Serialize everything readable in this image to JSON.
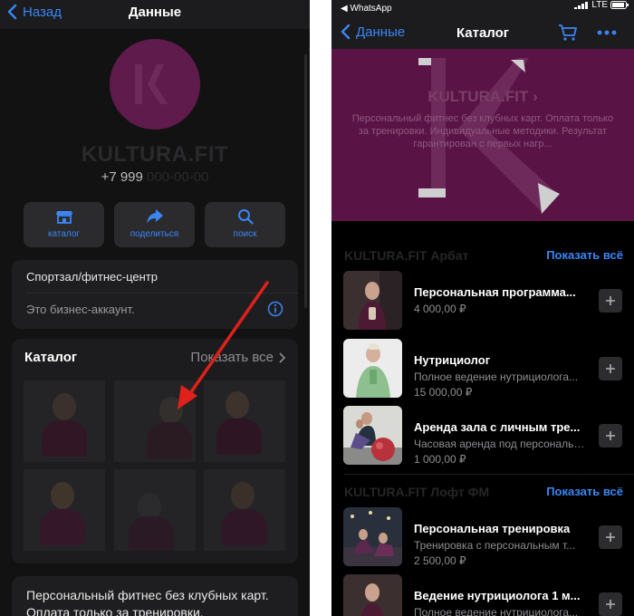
{
  "left": {
    "nav": {
      "back_label": "Назад",
      "title": "Данные"
    },
    "profile": {
      "name": "KULTURA.FIT",
      "phone_visible": "+7 999",
      "phone_hidden": "000-00-00"
    },
    "actions": [
      {
        "label": "каталог",
        "icon": "storefront-icon"
      },
      {
        "label": "поделиться",
        "icon": "share-arrow-icon"
      },
      {
        "label": "поиск",
        "icon": "search-icon"
      }
    ],
    "info": {
      "category": "Спортзал/фитнес-центр",
      "account_type": "Это бизнес-аккаунт."
    },
    "catalog": {
      "title": "Каталог",
      "show_all": "Показать все"
    },
    "description": "Персональный фитнес без клубных карт. Оплата только за тренировки."
  },
  "right": {
    "status": {
      "app": "◀ WhatsApp",
      "network": "LTE"
    },
    "nav": {
      "back_label": "Данные",
      "title": "Каталог"
    },
    "banner": {
      "title": "KULTURA.FIT ›",
      "subtitle": "Персональный фитнес без клубных карт. Оплата только за тренировки. Индивидуальные методики. Результат гарантирован с первых нагр..."
    },
    "sections": [
      {
        "name": "KULTURA.FIT Арбат",
        "show_all": "Показать всё",
        "items": [
          {
            "title": "Персональная программа...",
            "desc": "",
            "price": "4 000,00 ₽"
          },
          {
            "title": "Нутрициолог",
            "desc": "Полное ведение нутрициолога...",
            "price": "15 000,00 ₽"
          },
          {
            "title": "Аренда зала с личным тре...",
            "desc": "Часовая аренда под персонально...",
            "price": "1 000,00 ₽"
          }
        ]
      },
      {
        "name": "KULTURA.FIT Лофт ФМ",
        "show_all": "Показать всё",
        "items": [
          {
            "title": "Персональная тренировка",
            "desc": "Тренировка с персональным т...",
            "price": "2 500,00 ₽"
          },
          {
            "title": "Ведение нутрициолога 1 м...",
            "desc": "Полное ведение нутрициолога...",
            "price": ""
          }
        ]
      }
    ]
  },
  "colors": {
    "accent": "#3a86f5",
    "brand": "#5f1b4b",
    "annotation": "#e0201a"
  }
}
